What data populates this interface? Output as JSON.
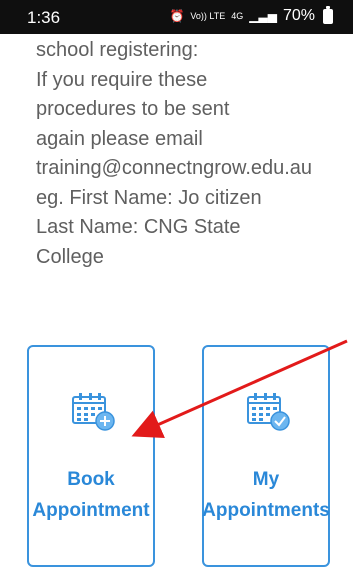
{
  "status_bar": {
    "time": "1:36",
    "alarm_icon": "alarm-icon",
    "volte_label": "Vo)) LTE",
    "network_label": "4G",
    "signal_icon": "signal-icon",
    "battery_percent": "70%"
  },
  "message": {
    "lines": [
      "school registering:",
      "If you require these",
      "procedures to be sent",
      "again please email",
      "training@connectngrow.edu.au",
      "eg. First Name: Jo citizen",
      "Last Name: CNG State",
      "College"
    ]
  },
  "tiles": [
    {
      "icon": "calendar-add-icon",
      "line1": "Book",
      "line2": "Appointment"
    },
    {
      "icon": "calendar-check-icon",
      "line1": "My",
      "line2": "Appointments"
    }
  ],
  "colors": {
    "accent": "#3a93dd",
    "text": "#5f5f5f",
    "annotation_arrow": "#e21a1a"
  }
}
